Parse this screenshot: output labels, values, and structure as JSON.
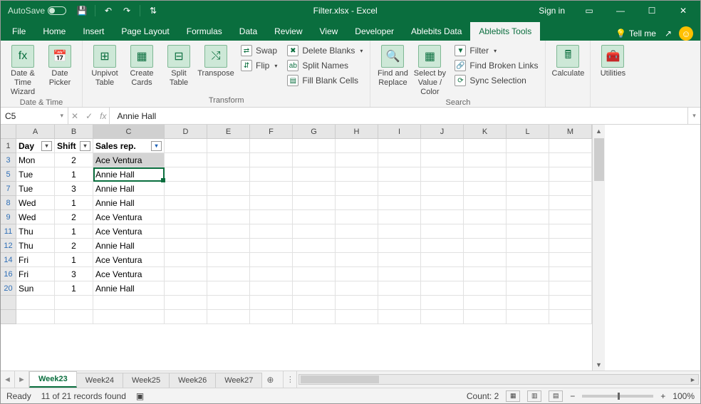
{
  "titlebar": {
    "autosave_label": "AutoSave",
    "autosave_state": "Off",
    "title": "Filter.xlsx - Excel",
    "signin": "Sign in"
  },
  "tabs": {
    "file": "File",
    "items": [
      "Home",
      "Insert",
      "Page Layout",
      "Formulas",
      "Data",
      "Review",
      "View",
      "Developer",
      "Ablebits Data",
      "Ablebits Tools"
    ],
    "active": "Ablebits Tools",
    "tellme": "Tell me"
  },
  "ribbon": {
    "groups": {
      "datetime": {
        "label": "Date & Time",
        "buttons": [
          "Date & Time Wizard",
          "Date Picker"
        ]
      },
      "transform": {
        "label": "Transform",
        "buttons": [
          "Unpivot Table",
          "Create Cards",
          "Split Table",
          "Transpose"
        ],
        "small": [
          "Swap",
          "Flip",
          "Delete Blanks",
          "Split Names",
          "Fill Blank Cells"
        ]
      },
      "search": {
        "label": "Search",
        "buttons": [
          "Find and Replace",
          "Select by Value / Color"
        ],
        "small": [
          "Filter",
          "Find Broken Links",
          "Sync Selection"
        ]
      },
      "calculate": {
        "label": "",
        "button": "Calculate"
      },
      "utilities": {
        "label": "",
        "button": "Utilities"
      }
    }
  },
  "formula_bar": {
    "namebox": "C5",
    "value": "Annie Hall",
    "fx": "fx"
  },
  "grid": {
    "cols": [
      "A",
      "B",
      "C",
      "D",
      "E",
      "F",
      "G",
      "H",
      "I",
      "J",
      "K",
      "L",
      "M"
    ],
    "headers": {
      "A": "Day",
      "B": "Shift",
      "C": "Sales rep."
    },
    "rows": [
      {
        "n": 3,
        "A": "Mon",
        "B": "2",
        "C": "Ace Ventura"
      },
      {
        "n": 5,
        "A": "Tue",
        "B": "1",
        "C": "Annie Hall"
      },
      {
        "n": 7,
        "A": "Tue",
        "B": "3",
        "C": "Annie Hall"
      },
      {
        "n": 8,
        "A": "Wed",
        "B": "1",
        "C": "Annie Hall"
      },
      {
        "n": 9,
        "A": "Wed",
        "B": "2",
        "C": "Ace Ventura"
      },
      {
        "n": 11,
        "A": "Thu",
        "B": "1",
        "C": "Ace Ventura"
      },
      {
        "n": 12,
        "A": "Thu",
        "B": "2",
        "C": "Annie Hall"
      },
      {
        "n": 14,
        "A": "Fri",
        "B": "1",
        "C": "Ace Ventura"
      },
      {
        "n": 16,
        "A": "Fri",
        "B": "3",
        "C": "Ace Ventura"
      },
      {
        "n": 20,
        "A": "Sun",
        "B": "1",
        "C": "Annie Hall"
      }
    ],
    "selected_cell": "C5",
    "selected_range": "C3"
  },
  "sheets": {
    "items": [
      "Week23",
      "Week24",
      "Week25",
      "Week26",
      "Week27"
    ],
    "active": "Week23"
  },
  "status": {
    "ready": "Ready",
    "filter": "11 of 21 records found",
    "count": "Count: 2",
    "zoom": "100%"
  }
}
